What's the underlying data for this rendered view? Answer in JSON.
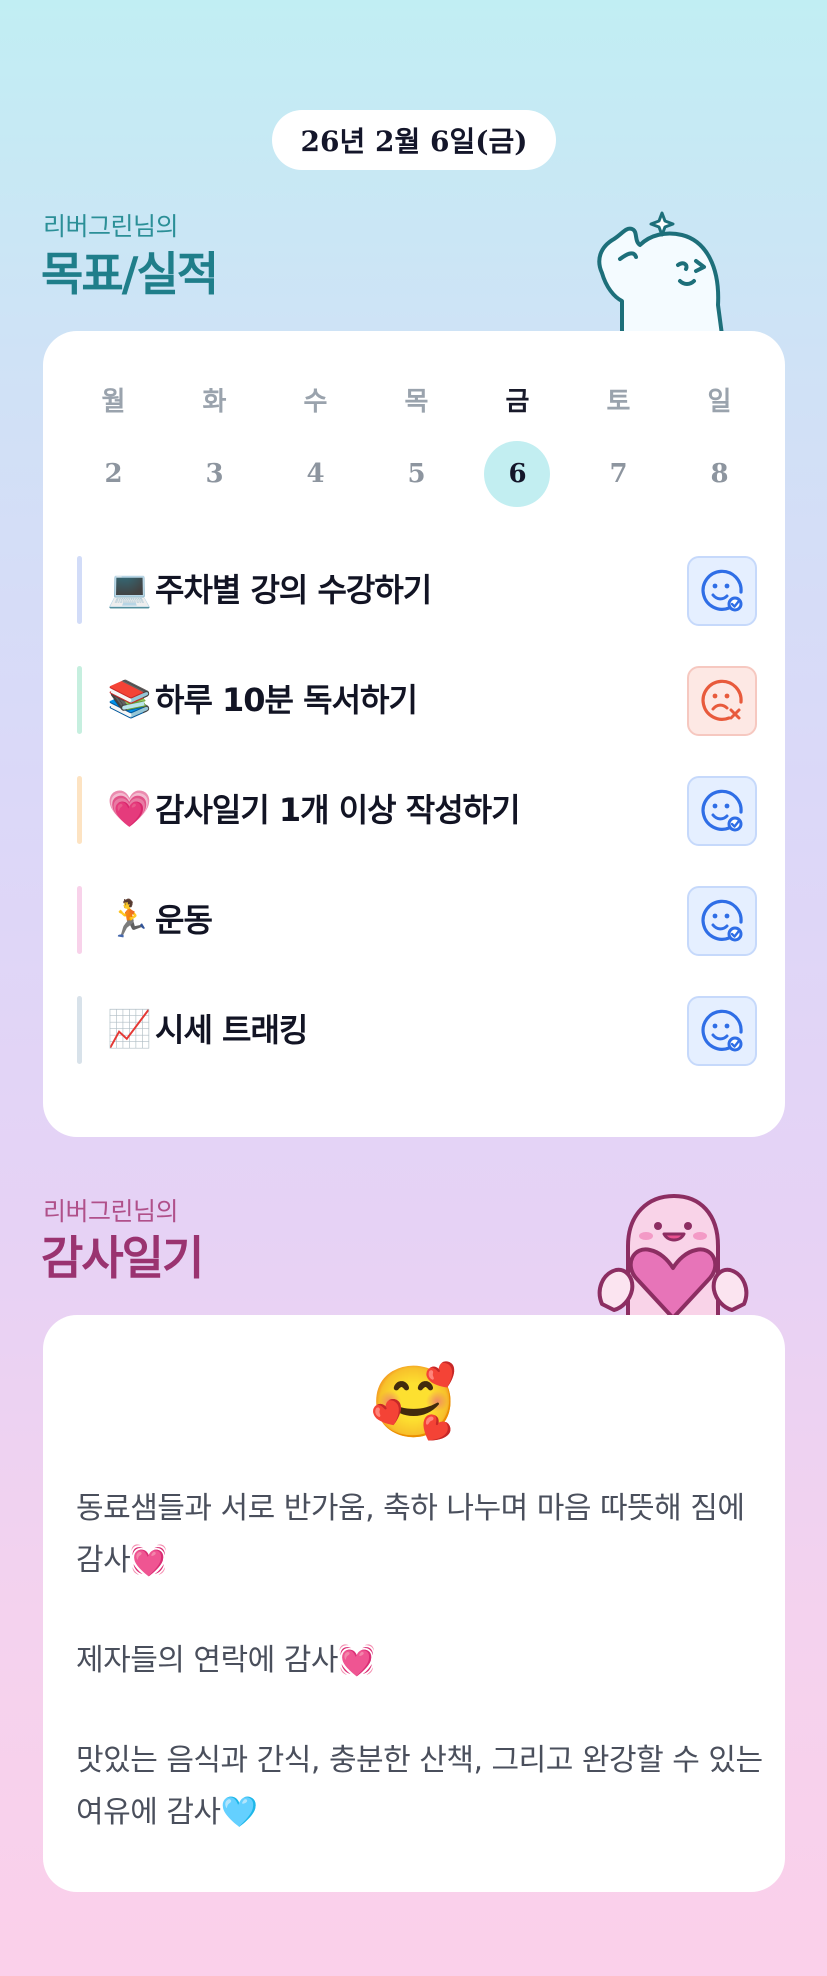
{
  "header": {
    "date": "26년 2월 6일(금)"
  },
  "goals_section": {
    "subtitle": "리버그린님의",
    "title": "목표/실적",
    "week": {
      "days": [
        "월",
        "화",
        "수",
        "목",
        "금",
        "토",
        "일"
      ],
      "dates": [
        "2",
        "3",
        "4",
        "5",
        "6",
        "7",
        "8"
      ],
      "selected_index": 4
    },
    "items": [
      {
        "emoji": "💻",
        "label": "주차별 강의 수강하기",
        "status": "done",
        "bar_color": "#d2dcf8"
      },
      {
        "emoji": "📚",
        "label": "하루 10분 독서하기",
        "status": "failed",
        "bar_color": "#c6efdf"
      },
      {
        "emoji": "💗",
        "label": "감사일기 1개 이상 작성하기",
        "status": "done",
        "bar_color": "#fde3c2"
      },
      {
        "emoji": "🏃",
        "label": "운동",
        "status": "done",
        "bar_color": "#f8d2ea"
      },
      {
        "emoji": "📈",
        "label": "시세 트래킹",
        "status": "done",
        "bar_color": "#d8e2ea"
      }
    ],
    "status_icons": {
      "done": "smile-check-icon",
      "failed": "sad-x-icon"
    },
    "colors": {
      "done": "#2f6ee6",
      "failed": "#e85a3c"
    }
  },
  "thanks_section": {
    "subtitle": "리버그린님의",
    "title": "감사일기",
    "mood_emoji": "🥰",
    "paragraphs": [
      "동료샘들과 서로 반가움, 축하 나누며 마음 따뜻해 짐에 감사💓",
      "제자들의 연락에 감사💓",
      "맛있는 음식과 간식, 충분한 산책, 그리고 완강할 수 있는 여유에 감사🩵"
    ]
  }
}
